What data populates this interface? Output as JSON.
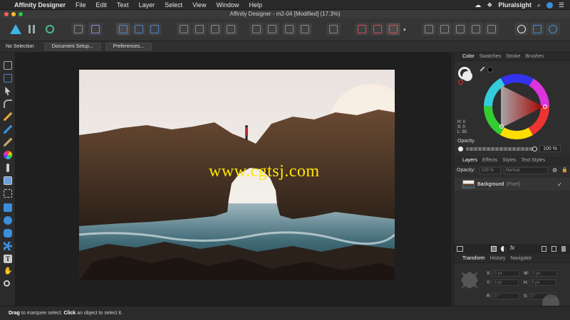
{
  "menubar": {
    "app_name": "Affinity Designer",
    "menus": [
      "File",
      "Edit",
      "Text",
      "Layer",
      "Select",
      "View",
      "Window",
      "Help"
    ],
    "brand": "Pluralsight"
  },
  "window": {
    "title": "Affinity Designer - m2-04 [Modified] (17.3%)"
  },
  "contextbar": {
    "selection_label": "No Selection",
    "document_setup": "Document Setup...",
    "preferences": "Preferences..."
  },
  "canvas": {
    "watermark": "www.cgtsj.com"
  },
  "color_panel": {
    "tabs": [
      "Color",
      "Swatches",
      "Stroke",
      "Brushes"
    ],
    "h": "H: 0",
    "s": "S: 0",
    "l": "L: 92",
    "opacity_label": "Opacity",
    "opacity_value": "100 %"
  },
  "layers_panel": {
    "tabs": [
      "Layers",
      "Effects",
      "Styles",
      "Text Styles"
    ],
    "opacity_label": "Opacity:",
    "opacity_value": "100 %",
    "blend_mode": "Normal",
    "layer_name": "Background",
    "layer_type": "(Pixel)"
  },
  "transform_panel": {
    "tabs": [
      "Transform",
      "History",
      "Navigator"
    ],
    "x": "X:",
    "x_val": "0 px",
    "y": "Y:",
    "y_val": "0 px",
    "w": "W:",
    "w_val": "0 px",
    "h": "H:",
    "h_val": "0 px",
    "r": "R:",
    "r_val": "0 °",
    "s": "S:",
    "s_val": "0 °"
  },
  "status": {
    "drag": "Drag",
    "drag_text": " to marquee select. ",
    "click": "Click",
    "click_text": " an object to select it."
  },
  "colors": {
    "accent": "#3b8fd9",
    "watermark": "#ffe600"
  }
}
